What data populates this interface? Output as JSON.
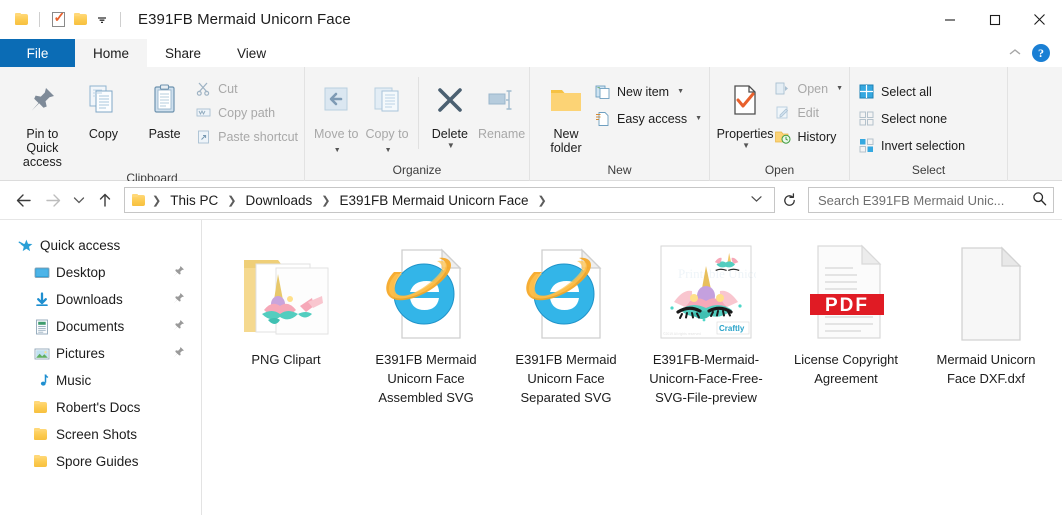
{
  "window": {
    "title": "E391FB Mermaid Unicorn Face",
    "quick_access_icons": [
      "folder-icon",
      "properties-icon",
      "folder-icon",
      "customize-caret-icon"
    ],
    "controls": {
      "minimize": "minimize-icon",
      "maximize": "maximize-icon",
      "close": "close-icon"
    }
  },
  "tabs": {
    "file": "File",
    "items": [
      "Home",
      "Share",
      "View"
    ],
    "active": "Home",
    "collapse_ribbon": "chevron-up-icon",
    "help": "?"
  },
  "ribbon": {
    "groups": [
      {
        "label": "Clipboard",
        "big_buttons": [
          {
            "label": "Pin to Quick access",
            "icon": "pin-icon",
            "dim": false
          },
          {
            "label": "Copy",
            "icon": "copy-icon",
            "dim": false
          },
          {
            "label": "Paste",
            "icon": "paste-icon",
            "dim": false
          }
        ],
        "small_buttons": [
          {
            "label": "Cut",
            "icon": "scissors-icon",
            "dim": true
          },
          {
            "label": "Copy path",
            "icon": "copy-path-icon",
            "dim": true
          },
          {
            "label": "Paste shortcut",
            "icon": "paste-shortcut-icon",
            "dim": true
          }
        ]
      },
      {
        "label": "Organize",
        "big_buttons": [
          {
            "label": "Move to",
            "icon": "move-to-icon",
            "dim": true,
            "caret": true
          },
          {
            "label": "Copy to",
            "icon": "copy-to-icon",
            "dim": true,
            "caret": true
          },
          {
            "label": "Delete",
            "icon": "delete-icon",
            "dim": false,
            "caret": true
          },
          {
            "label": "Rename",
            "icon": "rename-icon",
            "dim": true
          }
        ],
        "small_buttons": []
      },
      {
        "label": "New",
        "big_buttons": [
          {
            "label": "New folder",
            "icon": "new-folder-icon",
            "dim": false
          }
        ],
        "small_buttons": [
          {
            "label": "New item",
            "icon": "new-item-icon",
            "dim": false,
            "caret": true
          },
          {
            "label": "Easy access",
            "icon": "easy-access-icon",
            "dim": false,
            "caret": true
          }
        ]
      },
      {
        "label": "Open",
        "big_buttons": [
          {
            "label": "Properties",
            "icon": "properties-icon",
            "dim": false,
            "caret": true
          }
        ],
        "small_buttons": [
          {
            "label": "Open",
            "icon": "open-icon",
            "dim": true,
            "caret": true
          },
          {
            "label": "Edit",
            "icon": "edit-icon",
            "dim": true
          },
          {
            "label": "History",
            "icon": "history-icon",
            "dim": false
          }
        ]
      },
      {
        "label": "Select",
        "big_buttons": [],
        "small_buttons": [
          {
            "label": "Select all",
            "icon": "select-all-icon",
            "dim": false
          },
          {
            "label": "Select none",
            "icon": "select-none-icon",
            "dim": false
          },
          {
            "label": "Invert selection",
            "icon": "invert-selection-icon",
            "dim": false
          }
        ]
      }
    ]
  },
  "address": {
    "back": "back-arrow-icon",
    "forward": "forward-arrow-icon",
    "recent": "chevron-down-icon",
    "up": "up-arrow-icon",
    "crumbs": [
      "This PC",
      "Downloads",
      "E391FB Mermaid Unicorn Face"
    ],
    "dropdown_caret": "chevron-down-icon",
    "refresh": "refresh-icon",
    "search_placeholder": "Search E391FB Mermaid Unic...",
    "search_value": "",
    "search_icon": "search-icon"
  },
  "sidebar": {
    "items": [
      {
        "label": "Quick access",
        "icon": "star-icon",
        "level": 1,
        "pinned": false
      },
      {
        "label": "Desktop",
        "icon": "desktop-icon",
        "level": 2,
        "pinned": true
      },
      {
        "label": "Downloads",
        "icon": "downloads-icon",
        "level": 2,
        "pinned": true
      },
      {
        "label": "Documents",
        "icon": "documents-icon",
        "level": 2,
        "pinned": true
      },
      {
        "label": "Pictures",
        "icon": "pictures-icon",
        "level": 2,
        "pinned": true
      },
      {
        "label": "Music",
        "icon": "music-icon",
        "level": 2,
        "pinned": false
      },
      {
        "label": "Robert's Docs",
        "icon": "folder-icon",
        "level": 2,
        "pinned": false
      },
      {
        "label": "Screen Shots",
        "icon": "folder-icon",
        "level": 2,
        "pinned": false
      },
      {
        "label": "Spore Guides",
        "icon": "folder-icon",
        "level": 2,
        "pinned": false
      }
    ]
  },
  "files": [
    {
      "name": "PNG Clipart",
      "icon": "folder-thumbnail-icon"
    },
    {
      "name": "E391FB Mermaid Unicorn Face Assembled SVG",
      "icon": "internet-explorer-svg-icon"
    },
    {
      "name": "E391FB Mermaid Unicorn Face Separated SVG",
      "icon": "internet-explorer-svg-icon"
    },
    {
      "name": "E391FB-Mermaid-Unicorn-Face-Free-SVG-File-preview",
      "icon": "image-preview-icon"
    },
    {
      "name": "License Copyright Agreement",
      "icon": "pdf-icon"
    },
    {
      "name": "Mermaid Unicorn Face DXF.dxf",
      "icon": "blank-document-icon"
    }
  ],
  "colors": {
    "accent": "#0b6cb5",
    "ribbon_bg": "#f4f4f4",
    "pdf_red": "#e01b24",
    "folder_yellow": "#fcca4f"
  }
}
